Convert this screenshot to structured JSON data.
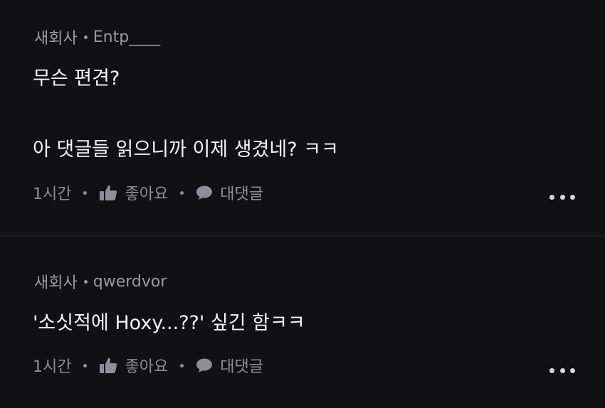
{
  "comments": [
    {
      "board": "새회사",
      "author": "Entp____",
      "line1": "무슨 편견?",
      "line2": "아 댓글들 읽으니까 이제 생겼네? ㅋㅋ",
      "time": "1시간",
      "like_label": "좋아요",
      "reply_label": "대댓글"
    },
    {
      "board": "새회사",
      "author": "qwerdvor",
      "line1": "'소싯적에 Hoxy...??' 싶긴 함ㅋㅋ",
      "time": "1시간",
      "like_label": "좋아요",
      "reply_label": "대댓글"
    }
  ],
  "icons": {
    "like": "thumbs-up-icon",
    "reply": "speech-bubble-icon",
    "more": "more-dots-icon"
  },
  "colors": {
    "background": "#111113",
    "text": "#f4f4f4",
    "meta": "#9a9aa0"
  }
}
